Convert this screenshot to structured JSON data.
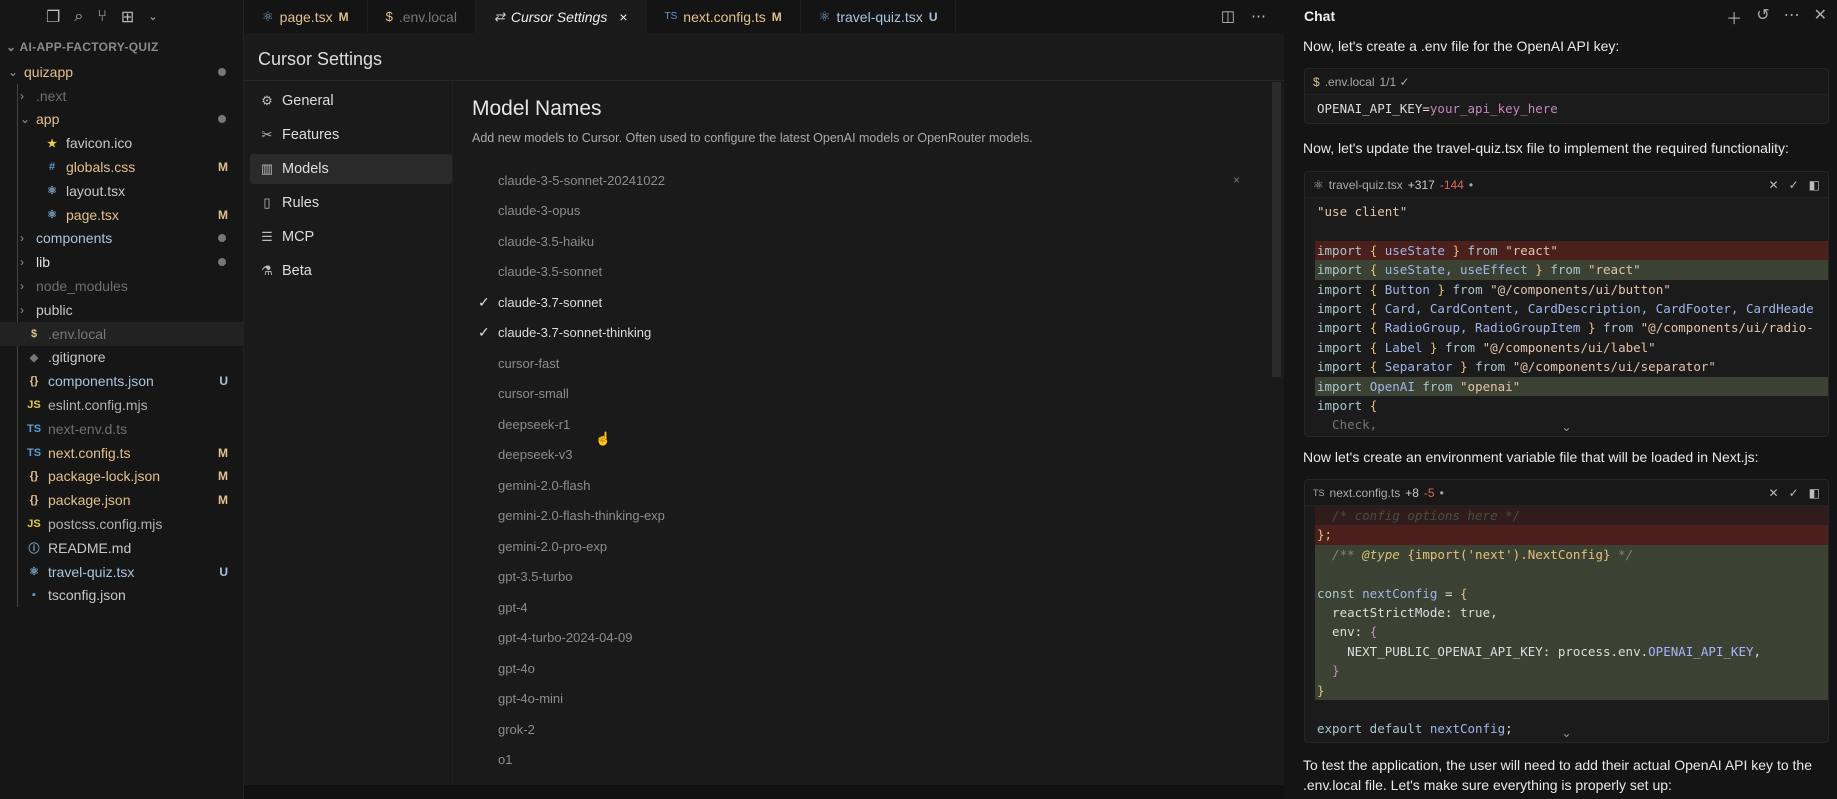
{
  "explorer": {
    "title": "AI-APP-FACTORY-QUIZ",
    "activity_icons": [
      "files-icon",
      "search-icon",
      "source-control-icon",
      "extensions-icon",
      "chevron-down-icon"
    ],
    "items": [
      {
        "name": "quizapp",
        "level": 0,
        "kind": "open",
        "color": "#e2c08d",
        "dot": true
      },
      {
        "name": ".next",
        "level": 1,
        "kind": "closed",
        "color": "#6f6f6f"
      },
      {
        "name": "app",
        "level": 1,
        "kind": "open",
        "color": "#e2c08d",
        "dot": true
      },
      {
        "name": "favicon.ico",
        "level": 2,
        "kind": "file",
        "icon": "★",
        "icolor": "#f0c94a",
        "color": "#c8c8c8"
      },
      {
        "name": "globals.css",
        "level": 2,
        "kind": "file",
        "icon": "#",
        "icolor": "#5a9bd5",
        "color": "#e2c08d",
        "badge": "M"
      },
      {
        "name": "layout.tsx",
        "level": 2,
        "kind": "file",
        "icon": "⚛",
        "icolor": "#7aa6c8",
        "color": "#c8c8c8"
      },
      {
        "name": "page.tsx",
        "level": 2,
        "kind": "file",
        "icon": "⚛",
        "icolor": "#7aa6c8",
        "color": "#e2c08d",
        "badge": "M"
      },
      {
        "name": "components",
        "level": 1,
        "kind": "closed",
        "color": "#a9c4e0",
        "dot": true
      },
      {
        "name": "lib",
        "level": 1,
        "kind": "closed",
        "color": "#e0e0e0",
        "dot": true
      },
      {
        "name": "node_modules",
        "level": 1,
        "kind": "closed",
        "color": "#6f6f6f"
      },
      {
        "name": "public",
        "level": 1,
        "kind": "closed",
        "color": "#c8c8c8"
      },
      {
        "name": ".env.local",
        "level": 1,
        "kind": "file",
        "icon": "$",
        "icolor": "#e2c08d",
        "color": "#777",
        "selected": true
      },
      {
        "name": ".gitignore",
        "level": 1,
        "kind": "file",
        "icon": "◆",
        "icolor": "#777",
        "color": "#c8c8c8"
      },
      {
        "name": "components.json",
        "level": 1,
        "kind": "file",
        "icon": "{}",
        "icolor": "#e2c08d",
        "color": "#a9c4e0",
        "badge": "U"
      },
      {
        "name": "eslint.config.mjs",
        "level": 1,
        "kind": "file",
        "icon": "JS",
        "icolor": "#e2c94a",
        "color": "#b0b0b0"
      },
      {
        "name": "next-env.d.ts",
        "level": 1,
        "kind": "file",
        "icon": "TS",
        "icolor": "#5a9bd5",
        "color": "#6f6f6f"
      },
      {
        "name": "next.config.ts",
        "level": 1,
        "kind": "file",
        "icon": "TS",
        "icolor": "#5a9bd5",
        "color": "#e2c08d",
        "badge": "M"
      },
      {
        "name": "package-lock.json",
        "level": 1,
        "kind": "file",
        "icon": "{}",
        "icolor": "#e2c08d",
        "color": "#e2c08d",
        "badge": "M"
      },
      {
        "name": "package.json",
        "level": 1,
        "kind": "file",
        "icon": "{}",
        "icolor": "#e2c08d",
        "color": "#e2c08d",
        "badge": "M"
      },
      {
        "name": "postcss.config.mjs",
        "level": 1,
        "kind": "file",
        "icon": "JS",
        "icolor": "#e2c94a",
        "color": "#b0b0b0"
      },
      {
        "name": "README.md",
        "level": 1,
        "kind": "file",
        "icon": "ⓘ",
        "icolor": "#7aa6c8",
        "color": "#c8c8c8"
      },
      {
        "name": "travel-quiz.tsx",
        "level": 1,
        "kind": "file",
        "icon": "⚛",
        "icolor": "#7aa6c8",
        "color": "#a9c4e0",
        "badge": "U"
      },
      {
        "name": "tsconfig.json",
        "level": 1,
        "kind": "file",
        "icon": "▪",
        "icolor": "#5a9bd5",
        "color": "#c8c8c8"
      }
    ]
  },
  "tabs": [
    {
      "label": "page.tsx",
      "icon": "⚛",
      "icolor": "#7aa6c8",
      "color": "#e2c08d",
      "badge": "M"
    },
    {
      "label": ".env.local",
      "icon": "$",
      "icolor": "#e2c08d",
      "color": "#777"
    },
    {
      "label": "Cursor Settings",
      "icon": "⇄",
      "icolor": "#ccc",
      "color": "#eee",
      "active": true,
      "close": "×"
    },
    {
      "label": "next.config.ts",
      "icon": "TS",
      "icolor": "#5a9bd5",
      "color": "#e2c08d",
      "badge": "M"
    },
    {
      "label": "travel-quiz.tsx",
      "icon": "⚛",
      "icolor": "#7aa6c8",
      "color": "#a9c4e0",
      "badge": "U"
    }
  ],
  "settings": {
    "title": "Cursor Settings",
    "nav": [
      {
        "label": "General",
        "icon": "⚙"
      },
      {
        "label": "Features",
        "icon": "✂"
      },
      {
        "label": "Models",
        "icon": "▥",
        "active": true
      },
      {
        "label": "Rules",
        "icon": "▯"
      },
      {
        "label": "MCP",
        "icon": "☰"
      },
      {
        "label": "Beta",
        "icon": "⚗"
      }
    ],
    "section_title": "Model Names",
    "section_desc": "Add new models to Cursor. Often used to configure the latest OpenAI models or OpenRouter models.",
    "models": [
      {
        "name": "claude-3-5-sonnet-20241022",
        "checked": false,
        "remove": "×"
      },
      {
        "name": "claude-3-opus",
        "checked": false
      },
      {
        "name": "claude-3.5-haiku",
        "checked": false
      },
      {
        "name": "claude-3.5-sonnet",
        "checked": false
      },
      {
        "name": "claude-3.7-sonnet",
        "checked": true
      },
      {
        "name": "claude-3.7-sonnet-thinking",
        "checked": true
      },
      {
        "name": "cursor-fast",
        "checked": false
      },
      {
        "name": "cursor-small",
        "checked": false
      },
      {
        "name": "deepseek-r1",
        "checked": false
      },
      {
        "name": "deepseek-v3",
        "checked": false
      },
      {
        "name": "gemini-2.0-flash",
        "checked": false
      },
      {
        "name": "gemini-2.0-flash-thinking-exp",
        "checked": false
      },
      {
        "name": "gemini-2.0-pro-exp",
        "checked": false
      },
      {
        "name": "gpt-3.5-turbo",
        "checked": false
      },
      {
        "name": "gpt-4",
        "checked": false
      },
      {
        "name": "gpt-4-turbo-2024-04-09",
        "checked": false
      },
      {
        "name": "gpt-4o",
        "checked": false
      },
      {
        "name": "gpt-4o-mini",
        "checked": false
      },
      {
        "name": "grok-2",
        "checked": false
      },
      {
        "name": "o1",
        "checked": false
      }
    ]
  },
  "chat": {
    "title": "Chat",
    "msg1": "Now, let's create a .env file for the OpenAI API key:",
    "env_block": {
      "file": ".env.local",
      "meta": "1/1 ✓",
      "lines": [
        {
          "k": "",
          "s": [
            [
              "OPENAI_API_KEY=",
              "txt"
            ],
            [
              "your_api_key_here",
              "pk"
            ]
          ]
        }
      ]
    },
    "msg2": "Now, let's update the travel-quiz.tsx file to implement the required functionality:",
    "quiz_block": {
      "file": "travel-quiz.tsx",
      "added": "+317",
      "removed": "-144",
      "lines": [
        {
          "k": "",
          "s": [
            [
              "\"use client\"",
              "str"
            ]
          ]
        },
        {
          "k": "",
          "s": [
            [
              "",
              ""
            ]
          ]
        },
        {
          "k": "del",
          "s": [
            [
              "import ",
              "kw"
            ],
            [
              "{ ",
              "br"
            ],
            [
              "useState ",
              "id"
            ],
            [
              "} ",
              "br"
            ],
            [
              "from ",
              "kw"
            ],
            [
              "\"react\"",
              "str"
            ]
          ]
        },
        {
          "k": "add",
          "s": [
            [
              "import ",
              "kw"
            ],
            [
              "{ ",
              "br"
            ],
            [
              "useState, useEffect ",
              "id"
            ],
            [
              "} ",
              "br"
            ],
            [
              "from ",
              "kw"
            ],
            [
              "\"react\"",
              "str"
            ]
          ]
        },
        {
          "k": "",
          "s": [
            [
              "import ",
              "kw"
            ],
            [
              "{ ",
              "br"
            ],
            [
              "Button ",
              "id"
            ],
            [
              "} ",
              "br"
            ],
            [
              "from ",
              "kw"
            ],
            [
              "\"@/components/ui/button\"",
              "str"
            ]
          ]
        },
        {
          "k": "",
          "s": [
            [
              "import ",
              "kw"
            ],
            [
              "{ ",
              "br"
            ],
            [
              "Card, CardContent, CardDescription, CardFooter, CardHeade",
              "id"
            ]
          ]
        },
        {
          "k": "",
          "s": [
            [
              "import ",
              "kw"
            ],
            [
              "{ ",
              "br"
            ],
            [
              "RadioGroup, RadioGroupItem ",
              "id"
            ],
            [
              "} ",
              "br"
            ],
            [
              "from ",
              "kw"
            ],
            [
              "\"@/components/ui/radio-",
              "str"
            ]
          ]
        },
        {
          "k": "",
          "s": [
            [
              "import ",
              "kw"
            ],
            [
              "{ ",
              "br"
            ],
            [
              "Label ",
              "id"
            ],
            [
              "} ",
              "br"
            ],
            [
              "from ",
              "kw"
            ],
            [
              "\"@/components/ui/label\"",
              "str"
            ]
          ]
        },
        {
          "k": "",
          "s": [
            [
              "import ",
              "kw"
            ],
            [
              "{ ",
              "br"
            ],
            [
              "Separator ",
              "id"
            ],
            [
              "} ",
              "br"
            ],
            [
              "from ",
              "kw"
            ],
            [
              "\"@/components/ui/separator\"",
              "str"
            ]
          ]
        },
        {
          "k": "add",
          "s": [
            [
              "import ",
              "kw"
            ],
            [
              "OpenAI ",
              "id"
            ],
            [
              "from ",
              "kw"
            ],
            [
              "\"openai\"",
              "str"
            ]
          ]
        },
        {
          "k": "",
          "s": [
            [
              "import ",
              "kw"
            ],
            [
              "{",
              "br"
            ]
          ]
        },
        {
          "k": "fade",
          "s": [
            [
              "  Check,",
              "txt"
            ]
          ]
        }
      ]
    },
    "msg3": "Now let's create an environment variable file that will be loaded in Next.js:",
    "next_block": {
      "file": "next.config.ts",
      "added": "+8",
      "removed": "-5",
      "lines": [
        {
          "k": "del fade",
          "s": [
            [
              "  /* config options here */",
              "cm"
            ]
          ]
        },
        {
          "k": "del",
          "s": [
            [
              "};",
              "br"
            ]
          ]
        },
        {
          "k": "add",
          "s": [
            [
              "  /** ",
              "cm"
            ],
            [
              "@type ",
              "ty"
            ],
            [
              "{import('next').NextConfig}",
              "br"
            ],
            [
              " */",
              "cm"
            ]
          ]
        },
        {
          "k": "add",
          "s": [
            [
              "",
              ""
            ]
          ]
        },
        {
          "k": "add",
          "s": [
            [
              "const ",
              "kw"
            ],
            [
              "nextConfig ",
              "id"
            ],
            [
              "= ",
              "txt"
            ],
            [
              "{",
              "br"
            ]
          ]
        },
        {
          "k": "add",
          "s": [
            [
              "  reactStrictMode: true,",
              "txt"
            ]
          ]
        },
        {
          "k": "add",
          "s": [
            [
              "  env: ",
              "txt"
            ],
            [
              "{",
              "pk"
            ]
          ]
        },
        {
          "k": "add",
          "s": [
            [
              "    NEXT_PUBLIC_OPENAI_API_KEY: process.env.",
              "txt"
            ],
            [
              "OPENAI_API_KEY",
              "cn"
            ],
            [
              ",",
              "txt"
            ]
          ]
        },
        {
          "k": "add",
          "s": [
            [
              "  }",
              "pk"
            ]
          ]
        },
        {
          "k": "add",
          "s": [
            [
              "}",
              "br"
            ]
          ]
        },
        {
          "k": "",
          "s": [
            [
              "",
              ""
            ]
          ]
        },
        {
          "k": "",
          "s": [
            [
              "export default ",
              "kw"
            ],
            [
              "nextConfig",
              "id"
            ],
            [
              ";",
              "txt"
            ]
          ]
        }
      ]
    },
    "msg4": "To test the application, the user will need to add their actual OpenAI API key to the .env.local file. Let's make sure everything is properly set up:"
  }
}
